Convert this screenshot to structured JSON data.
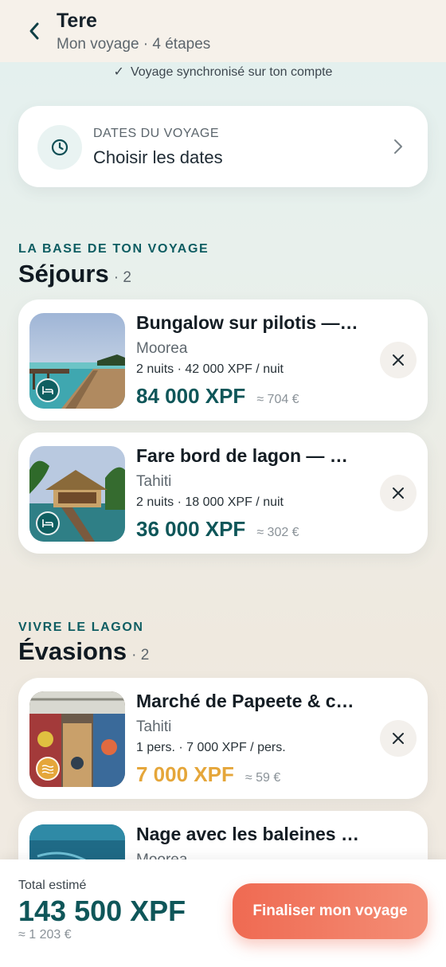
{
  "header": {
    "title": "Tere",
    "subtitle": "Mon voyage · 4 étapes"
  },
  "sync_status": "Voyage synchronisé sur ton compte",
  "dates": {
    "label": "DATES DU VOYAGE",
    "value": "Choisir les dates"
  },
  "stays_section": {
    "kicker": "LA BASE DE TON VOYAGE",
    "title": "Séjours",
    "count": "· 2",
    "items": [
      {
        "title": "Bungalow sur pilotis — …",
        "location": "Moorea",
        "meta": "2 nuits · 42 000 XPF / nuit",
        "price": "84 000 XPF",
        "approx": "≈ 704 €",
        "badge_icon": "bed-icon"
      },
      {
        "title": "Fare bord de lagon — Pu…",
        "location": "Tahiti",
        "meta": "2 nuits · 18 000 XPF / nuit",
        "price": "36 000 XPF",
        "approx": "≈ 302 €",
        "badge_icon": "bed-icon"
      }
    ]
  },
  "escapes_section": {
    "kicker": "VIVRE LE LAGON",
    "title": "Évasions",
    "count": "· 2",
    "items": [
      {
        "title": "Marché de Papeete & c…",
        "location": "Tahiti",
        "meta": "1 pers. · 7 000 XPF / pers.",
        "price": "7 000 XPF",
        "approx": "≈ 59 €",
        "badge_icon": "waves-icon"
      },
      {
        "title": "Nage avec les baleines à…",
        "location": "Moorea"
      }
    ]
  },
  "footer": {
    "total_label": "Total estimé",
    "total_value": "143 500 XPF",
    "total_approx": "≈ 1 203 €",
    "cta_label": "Finaliser mon voyage"
  },
  "colors": {
    "teal": "#0f5659",
    "gold": "#e5a63a",
    "coral": "#ef6a52"
  }
}
